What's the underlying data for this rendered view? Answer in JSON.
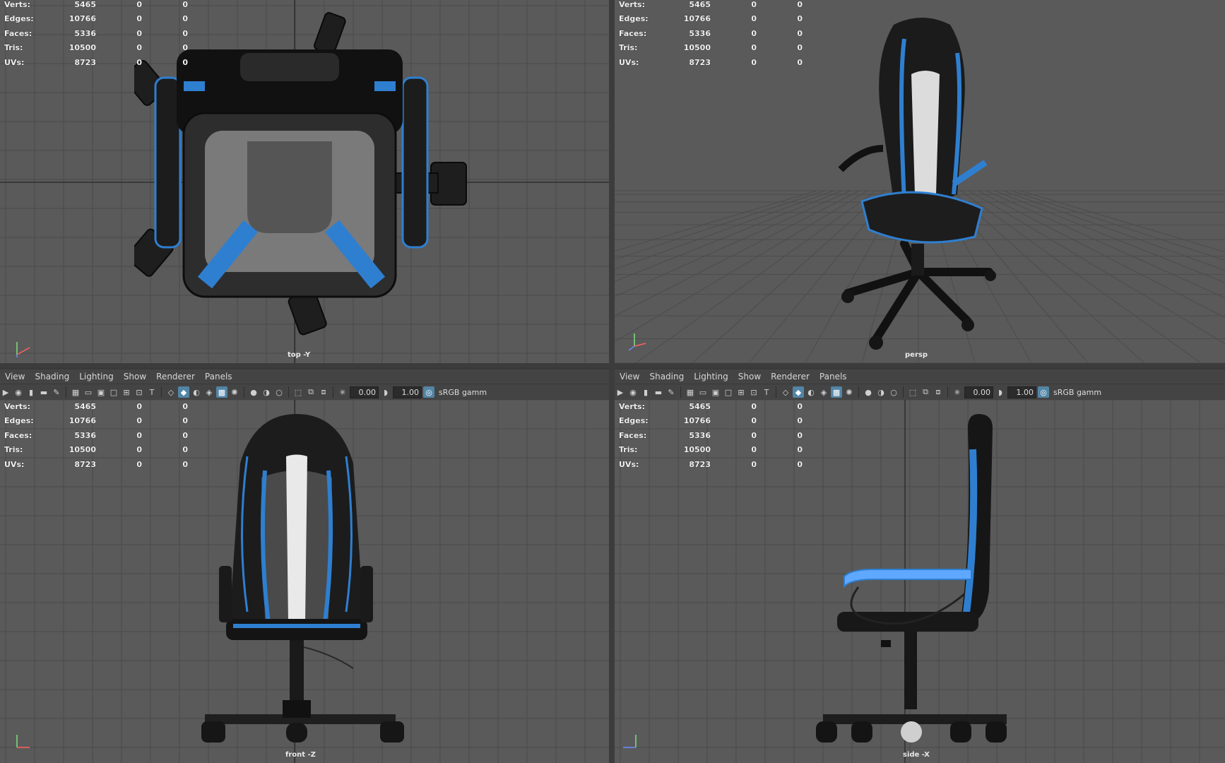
{
  "stats": {
    "rows": [
      {
        "label": "Verts:",
        "v": "5465",
        "a": "0",
        "b": "0"
      },
      {
        "label": "Edges:",
        "v": "10766",
        "a": "0",
        "b": "0"
      },
      {
        "label": "Faces:",
        "v": "5336",
        "a": "0",
        "b": "0"
      },
      {
        "label": "Tris:",
        "v": "10500",
        "a": "0",
        "b": "0"
      },
      {
        "label": "UVs:",
        "v": "8723",
        "a": "0",
        "b": "0"
      }
    ]
  },
  "panels": {
    "top": {
      "camera": "top -Y"
    },
    "persp": {
      "camera": "persp"
    },
    "front": {
      "camera": "front -Z"
    },
    "side": {
      "camera": "side -X"
    }
  },
  "menu": {
    "view": "View",
    "shading": "Shading",
    "lighting": "Lighting",
    "show": "Show",
    "renderer": "Renderer",
    "panels": "Panels"
  },
  "toolbar": {
    "exposure": "0.00",
    "gamma": "1.00",
    "colorspace": "sRGB gamm"
  },
  "colors": {
    "viewport_bg": "#5a5a5a",
    "accent_blue": "#2f7fd0",
    "active_icon": "#5285a6"
  }
}
